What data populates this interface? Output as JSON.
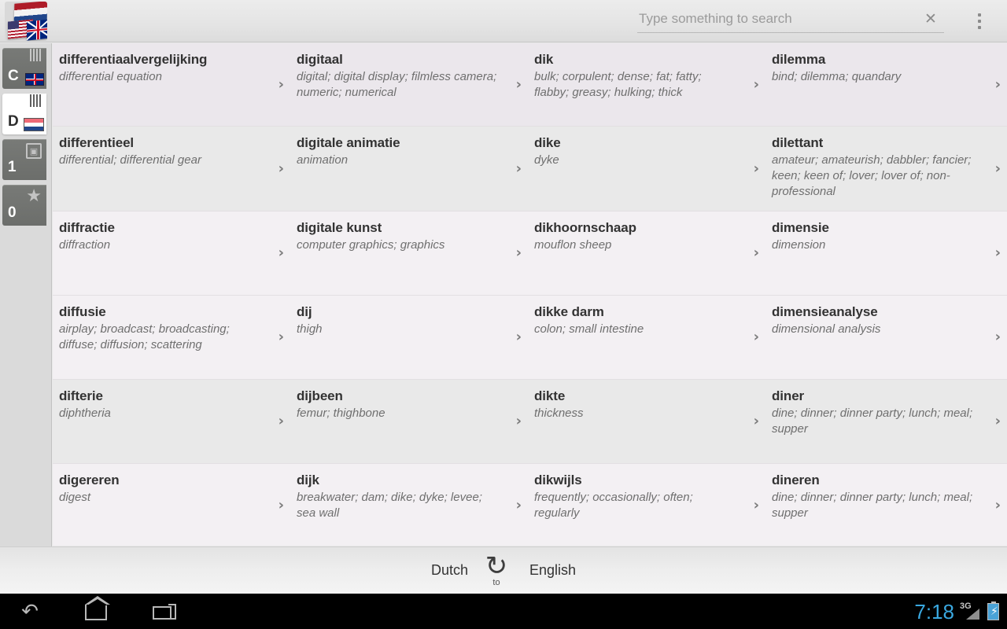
{
  "topbar": {
    "back_icon": "chevron-left-icon",
    "app_icon_name": "dictionary-flags-icon",
    "search": {
      "placeholder": "Type something to search",
      "value": "",
      "clear_icon": "close-icon"
    },
    "overflow_icon": "more-vertical-icon"
  },
  "sidebar": {
    "tabs": [
      {
        "letter": "C",
        "name": "tab-english",
        "badge": "uk-flag-icon",
        "selected": false
      },
      {
        "letter": "D",
        "name": "tab-dutch",
        "badge": "nl-flag-icon",
        "selected": true
      },
      {
        "letter": "1",
        "name": "tab-history",
        "badge": "history-icon",
        "selected": false
      },
      {
        "letter": "0",
        "name": "tab-favorites",
        "badge": "star-icon",
        "selected": false
      }
    ]
  },
  "bottombar": {
    "source_language": "Dutch",
    "target_language": "English",
    "swap_icon": "swap-refresh-icon",
    "swap_caption": "to"
  },
  "navbar": {
    "back_icon": "back-icon",
    "home_icon": "home-icon",
    "recents_icon": "recents-icon",
    "clock": "7:18",
    "network": "3G",
    "signal_icon": "signal-bars-icon",
    "battery_icon": "battery-charging-icon"
  },
  "list": {
    "chevron": "›",
    "rows": [
      [
        {
          "term": "differentiaalvergelijking",
          "defn": "differential equation"
        },
        {
          "term": "digitaal",
          "defn": "digital; digital display; filmless camera; numeric; numerical"
        },
        {
          "term": "dik",
          "defn": "bulk; corpulent; dense; fat; fatty; flabby; greasy; hulking; thick"
        },
        {
          "term": "dilemma",
          "defn": "bind; dilemma; quandary"
        }
      ],
      [
        {
          "term": "differentieel",
          "defn": "differential; differential gear"
        },
        {
          "term": "digitale animatie",
          "defn": "animation"
        },
        {
          "term": "dike",
          "defn": "dyke"
        },
        {
          "term": "dilettant",
          "defn": "amateur; amateurish; dabbler; fancier; keen; keen of; lover; lover of; non-professional"
        }
      ],
      [
        {
          "term": "diffractie",
          "defn": "diffraction"
        },
        {
          "term": "digitale kunst",
          "defn": "computer graphics; graphics"
        },
        {
          "term": "dikhoornschaap",
          "defn": "mouflon sheep"
        },
        {
          "term": "dimensie",
          "defn": "dimension"
        }
      ],
      [
        {
          "term": "diffusie",
          "defn": "airplay; broadcast; broadcasting; diffuse; diffusion; scattering"
        },
        {
          "term": "dij",
          "defn": "thigh"
        },
        {
          "term": "dikke darm",
          "defn": "colon; small intestine"
        },
        {
          "term": "dimensieanalyse",
          "defn": "dimensional analysis"
        }
      ],
      [
        {
          "term": "difterie",
          "defn": "diphtheria"
        },
        {
          "term": "dijbeen",
          "defn": "femur; thighbone"
        },
        {
          "term": "dikte",
          "defn": "thickness"
        },
        {
          "term": "diner",
          "defn": "dine; dinner; dinner party; lunch; meal; supper"
        }
      ],
      [
        {
          "term": "digereren",
          "defn": "digest"
        },
        {
          "term": "dijk",
          "defn": "breakwater; dam; dike; dyke; levee; sea wall"
        },
        {
          "term": "dikwijls",
          "defn": "frequently; occasionally; often; regularly"
        },
        {
          "term": "dineren",
          "defn": "dine; dinner; dinner party; lunch; meal; supper"
        }
      ]
    ]
  },
  "colors": {
    "row_tint_a": "#ebe7ec",
    "row_tint_b": "#e9e9e9",
    "row_tint_c": "#f3f0f3",
    "accent_clock": "#3aa8e0",
    "term_color": "#333333",
    "defn_color": "#6f6f6f"
  }
}
